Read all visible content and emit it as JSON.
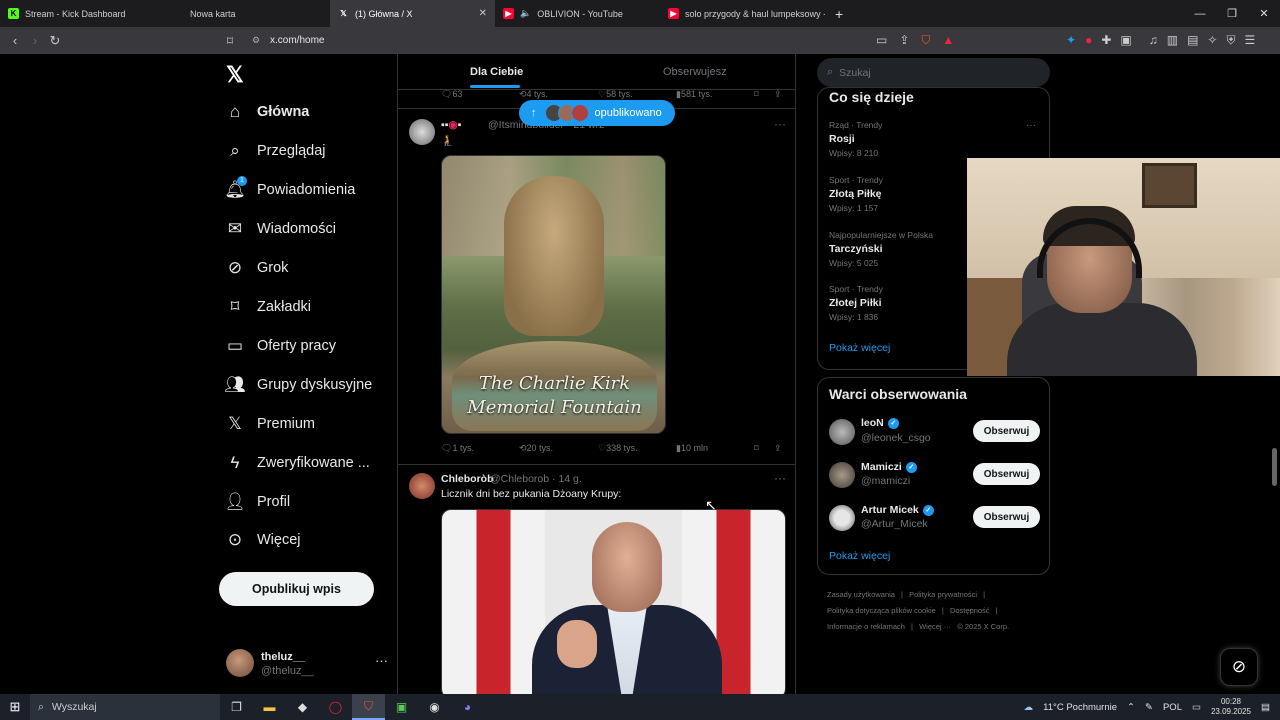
{
  "browser": {
    "tabs": [
      {
        "title": "Stream - Kick Dashboard",
        "icon": "kick-icon",
        "color": "#53fc18"
      },
      {
        "title": "Nowa karta",
        "icon": "",
        "color": ""
      },
      {
        "title": "(1) Główna / X",
        "icon": "x-icon",
        "color": "#ffffff"
      },
      {
        "title": "OBLIVION - YouTube",
        "icon": "youtube-icon",
        "color": "#ff0033"
      },
      {
        "title": "solo przygody & haul lumpeksowy -",
        "icon": "youtube-icon",
        "color": "#ff0033"
      }
    ],
    "url": "x.com/home"
  },
  "nav": {
    "items": [
      {
        "label": "Główna",
        "icon": "home-icon"
      },
      {
        "label": "Przeglądaj",
        "icon": "search-icon"
      },
      {
        "label": "Powiadomienia",
        "icon": "bell-icon",
        "badge": "1"
      },
      {
        "label": "Wiadomości",
        "icon": "mail-icon"
      },
      {
        "label": "Grok",
        "icon": "grok-icon"
      },
      {
        "label": "Zakładki",
        "icon": "bookmark-icon"
      },
      {
        "label": "Oferty pracy",
        "icon": "briefcase-icon"
      },
      {
        "label": "Grupy dyskusyjne",
        "icon": "people-icon"
      },
      {
        "label": "Premium",
        "icon": "x-icon"
      },
      {
        "label": "Zweryfikowane ...",
        "icon": "lightning-icon"
      },
      {
        "label": "Profil",
        "icon": "person-icon"
      },
      {
        "label": "Więcej",
        "icon": "more-circle-icon"
      }
    ],
    "publish_label": "Opublikuj wpis",
    "profile": {
      "name": "theluz__",
      "handle": "@theluz__"
    }
  },
  "feed": {
    "tabs": {
      "for_you": "Dla Ciebie",
      "following": "Obserwujesz"
    },
    "new_posts_label": "opublikowano",
    "prev_actions": {
      "replies": "63",
      "reposts": "4 tys.",
      "likes": "58 tys.",
      "views": "581 tys."
    },
    "tweet1": {
      "handle": "@Itsmindbuilder",
      "time": "· 21 wrz",
      "text": "🧎",
      "image_caption_line1": "The Charlie Kirk",
      "image_caption_line2": "Memorial Fountain",
      "actions": {
        "replies": "1 tys.",
        "reposts": "20 tys.",
        "likes": "338 tys.",
        "views": "10 mln"
      }
    },
    "tweet2": {
      "name": "Chleboròb",
      "handle": "@Chleborob",
      "time": "· 14 g.",
      "text": "Licznik dni bez pukania Dżoany Krupy:"
    }
  },
  "sidebar": {
    "search_placeholder": "Szukaj",
    "trends_title": "Co się dzieje",
    "trends": [
      {
        "context": "Rząd · Trendy",
        "name": "Rosji",
        "posts": "Wpisy: 8 210"
      },
      {
        "context": "Sport · Trendy",
        "name": "Złotą Piłkę",
        "posts": "Wpisy: 1 157"
      },
      {
        "context": "Najpopularniejsze w Polska",
        "name": "Tarczyński",
        "posts": "Wpisy: 5 025"
      },
      {
        "context": "Sport · Trendy",
        "name": "Złotej Piłki",
        "posts": "Wpisy: 1 836"
      }
    ],
    "trends_more": "Pokaż więcej",
    "who_title": "Warci obserwowania",
    "who": [
      {
        "name": "leoN",
        "handle": "@leonek_csgo",
        "button": "Obserwuj"
      },
      {
        "name": "Mamiczi",
        "handle": "@mamiczi",
        "button": "Obserwuj"
      },
      {
        "name": "Artur Micek",
        "handle": "@Artur_Micek",
        "button": "Obserwuj"
      }
    ],
    "who_more": "Pokaż więcej",
    "footer": [
      "Zasady użytkowania",
      "|",
      "Polityka prywatności",
      "|",
      "Polityka dotycząca plików cookie",
      "|",
      "Dostępność",
      "|",
      "Informacje o reklamach",
      "|",
      "Więcej ···",
      "© 2025 X Corp."
    ]
  },
  "taskbar": {
    "search_placeholder": "Wyszukaj",
    "weather": "11°C  Pochmurnie",
    "lang": "POL",
    "time": "00:28",
    "date": "23.09.2025"
  }
}
